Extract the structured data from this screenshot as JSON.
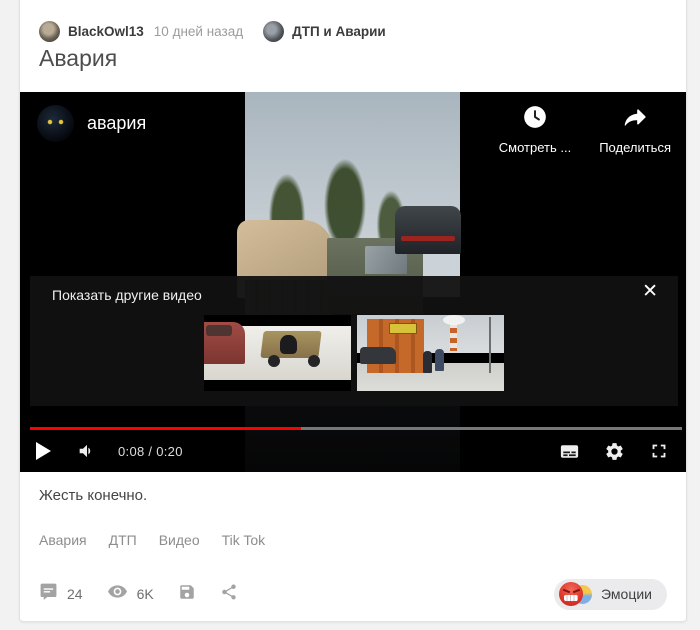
{
  "post": {
    "author": "BlackOwl13",
    "posted": "10 дней назад",
    "community": "ДТП и Аварии",
    "title": "Авария",
    "description": "Жесть конечно.",
    "tags": [
      "Авария",
      "ДТП",
      "Видео",
      "Tik Tok"
    ],
    "stats": {
      "comments": "24",
      "views": "6K"
    },
    "emotions_label": "Эмоции"
  },
  "player": {
    "video_title": "авария",
    "watch_later_label": "Смотреть ...",
    "share_label": "Поделиться",
    "suggestions": {
      "title": "Показать другие видео",
      "close_glyph": "✕"
    },
    "time_display": "0:08 / 0:20",
    "progress_percent": 41.5
  },
  "icons": {
    "watch-later": "clock",
    "share-arrow": "curved-arrow",
    "close": "✕",
    "play": "white-triangle",
    "volume": "speaker",
    "subtitles": "cc-box",
    "settings": "gear",
    "fullscreen": "corner-brackets",
    "comments": "speech-bubble",
    "views": "eye",
    "save": "floppy-disk",
    "share-post": "share-nodes"
  },
  "colors": {
    "page_bg": "#f1f2f1",
    "card_bg": "#ffffff",
    "player_bg": "#000000",
    "overlay_bg": "#111111",
    "progress_red": "#ff0000",
    "emotions_pill_bg": "#ebebed"
  }
}
